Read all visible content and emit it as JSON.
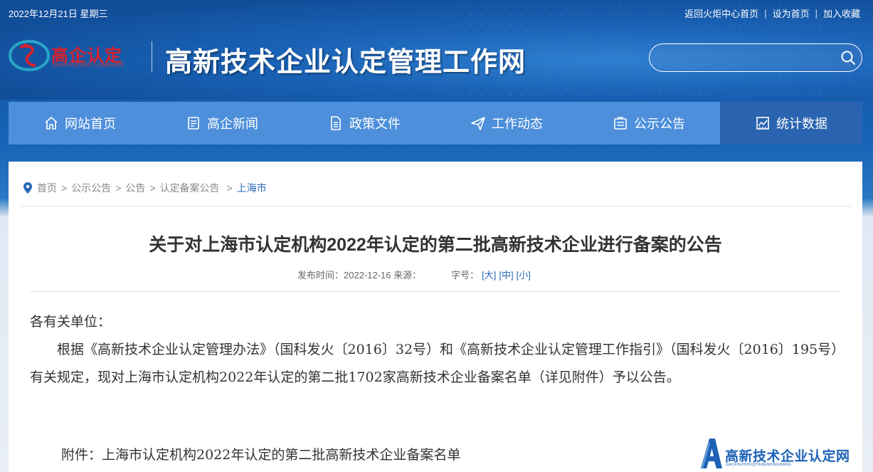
{
  "top": {
    "date": "2022年12月21日 星期三",
    "links": [
      "返回火炬中心首页",
      "设为首页",
      "加入收藏"
    ]
  },
  "logo": {
    "title": "高企认定",
    "subtitle": "INNOVATION COMPANY"
  },
  "site_title": "高新技术企业认定管理工作网",
  "search": {
    "placeholder": ""
  },
  "nav": [
    {
      "label": "网站首页",
      "icon": "home-icon"
    },
    {
      "label": "高企新闻",
      "icon": "news-icon"
    },
    {
      "label": "政策文件",
      "icon": "document-icon"
    },
    {
      "label": "工作动态",
      "icon": "send-icon"
    },
    {
      "label": "公示公告",
      "icon": "notice-icon"
    },
    {
      "label": "统计数据",
      "icon": "chart-icon"
    }
  ],
  "breadcrumb": {
    "items": [
      "首页",
      "公示公告",
      "公告",
      "认定备案公告"
    ],
    "current": "上海市"
  },
  "article": {
    "title": "关于对上海市认定机构2022年认定的第二批高新技术企业进行备案的公告",
    "meta_publish": "发布时间：2022-12-16 来源：",
    "meta_size_label": "字号：",
    "size_large": "[大]",
    "size_medium": "[中]",
    "size_small": "[小]",
    "salutation": "各有关单位：",
    "paragraph": "根据《高新技术企业认定管理办法》（国科发火〔2016〕32号）和《高新技术企业认定管理工作指引》（国科发火〔2016〕195号）有关规定，现对上海市认定机构2022年认定的第二批1702家高新技术企业备案名单（详见附件）予以公告。",
    "attachment": "附件：上海市认定机构2022年认定的第二批高新技术企业备案名单"
  },
  "watermark": {
    "title": "高新技术企业认定网",
    "subtitle": "GAOXINJISHUQIYERENDINGWANG"
  },
  "colors": {
    "header_blue": "#1a62b6",
    "nav_blue": "#4d8fdb",
    "nav_active": "#2a64b0",
    "link_blue": "#2567b6",
    "logo_red": "#d8212d"
  }
}
